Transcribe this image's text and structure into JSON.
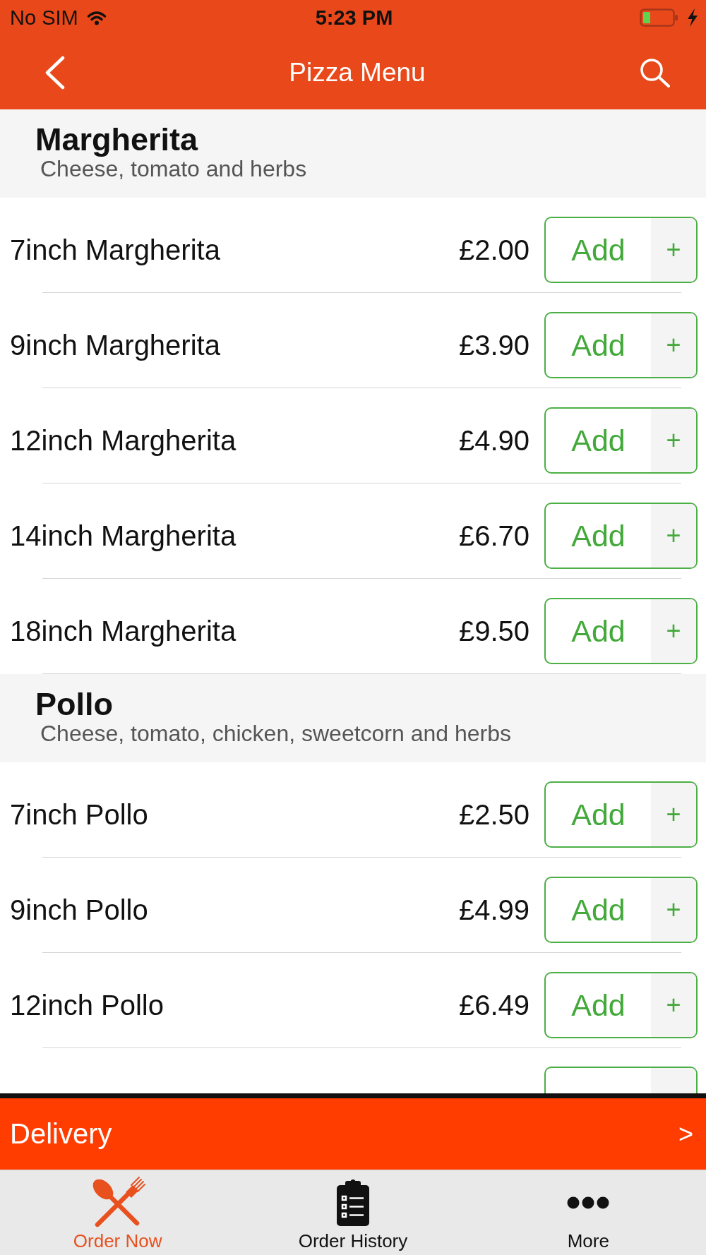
{
  "status_bar": {
    "carrier": "No SIM",
    "time": "5:23 PM"
  },
  "nav_bar": {
    "title": "Pizza Menu"
  },
  "sections": [
    {
      "title": "Margherita",
      "description": "Cheese, tomato and herbs",
      "items": [
        {
          "name": "7inch Margherita",
          "price": "£2.00",
          "button": "Add",
          "button_symbol": "+"
        },
        {
          "name": "9inch Margherita",
          "price": "£3.90",
          "button": "Add",
          "button_symbol": "+"
        },
        {
          "name": "12inch Margherita",
          "price": "£4.90",
          "button": "Add",
          "button_symbol": "+"
        },
        {
          "name": "14inch Margherita",
          "price": "£6.70",
          "button": "Add",
          "button_symbol": "+"
        },
        {
          "name": "18inch Margherita",
          "price": "£9.50",
          "button": "Add",
          "button_symbol": "+"
        }
      ]
    },
    {
      "title": "Pollo",
      "description": "Cheese, tomato, chicken, sweetcorn and herbs",
      "items": [
        {
          "name": "7inch Pollo",
          "price": "£2.50",
          "button": "Add",
          "button_symbol": "+"
        },
        {
          "name": "9inch Pollo",
          "price": "£4.99",
          "button": "Add",
          "button_symbol": "+"
        },
        {
          "name": "12inch Pollo",
          "price": "£6.49",
          "button": "Add",
          "button_symbol": "+"
        }
      ]
    }
  ],
  "delivery_bar": {
    "label": "Delivery",
    "arrow": ">"
  },
  "tab_bar": {
    "tabs": [
      {
        "label": "Order Now",
        "selected": true
      },
      {
        "label": "Order History",
        "selected": false
      },
      {
        "label": "More",
        "selected": false
      }
    ]
  }
}
